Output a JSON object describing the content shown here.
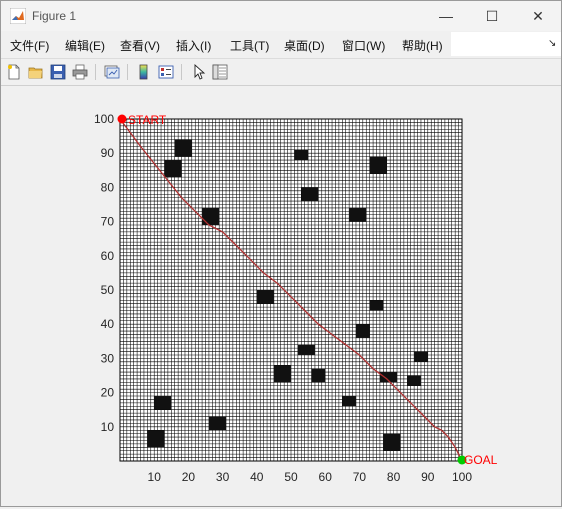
{
  "window": {
    "title": "Figure 1",
    "controls": {
      "minimize": "—",
      "maximize": "☐",
      "close": "✕"
    }
  },
  "menu": {
    "items": [
      {
        "label": "文件(F)"
      },
      {
        "label": "编辑(E)"
      },
      {
        "label": "查看(V)"
      },
      {
        "label": "插入(I)"
      },
      {
        "label": "工具(T)"
      },
      {
        "label": "桌面(D)"
      },
      {
        "label": "窗口(W)"
      },
      {
        "label": "帮助(H)"
      }
    ],
    "overflow_icon": "↘"
  },
  "toolbar": {
    "icons": [
      "new-figure-icon",
      "open-icon",
      "save-icon",
      "print-icon",
      "link-plot-icon",
      "colorbar-icon",
      "legend-icon",
      "edit-plot-icon",
      "property-inspector-icon"
    ]
  },
  "chart_data": {
    "type": "scatter",
    "grid": true,
    "grid_size": 100,
    "xlim": [
      0,
      100
    ],
    "ylim": [
      0,
      100
    ],
    "xticks": [
      "10",
      "20",
      "30",
      "40",
      "50",
      "60",
      "70",
      "80",
      "90",
      "100"
    ],
    "yticks": [
      "10",
      "20",
      "30",
      "40",
      "50",
      "60",
      "70",
      "80",
      "90",
      "100"
    ],
    "start": {
      "x": 0,
      "y": 100,
      "label": "START",
      "color": "#ff0000"
    },
    "goal": {
      "x": 100,
      "y": 0,
      "label": "GOAL",
      "color": "#00cc00",
      "label_color": "#ff0000"
    },
    "path_color": "#b03030",
    "path": [
      [
        0,
        100
      ],
      [
        3,
        96
      ],
      [
        6,
        92
      ],
      [
        10,
        87
      ],
      [
        14,
        82
      ],
      [
        18,
        77
      ],
      [
        22,
        73
      ],
      [
        26,
        69
      ],
      [
        30,
        67
      ],
      [
        34,
        63
      ],
      [
        38,
        59
      ],
      [
        42,
        55
      ],
      [
        46,
        52
      ],
      [
        50,
        48
      ],
      [
        54,
        44
      ],
      [
        58,
        40
      ],
      [
        62,
        37
      ],
      [
        66,
        34
      ],
      [
        70,
        31
      ],
      [
        74,
        27
      ],
      [
        78,
        24
      ],
      [
        82,
        20
      ],
      [
        86,
        16
      ],
      [
        88,
        14
      ],
      [
        90,
        12
      ],
      [
        92,
        10
      ],
      [
        94,
        9
      ],
      [
        96,
        7
      ],
      [
        98,
        4
      ],
      [
        100,
        0
      ]
    ],
    "obstacles": [
      {
        "x": 16,
        "y": 89,
        "w": 5,
        "h": 5
      },
      {
        "x": 13,
        "y": 83,
        "w": 5,
        "h": 5
      },
      {
        "x": 51,
        "y": 88,
        "w": 4,
        "h": 3
      },
      {
        "x": 73,
        "y": 84,
        "w": 5,
        "h": 5
      },
      {
        "x": 53,
        "y": 76,
        "w": 5,
        "h": 4
      },
      {
        "x": 24,
        "y": 69,
        "w": 5,
        "h": 5
      },
      {
        "x": 67,
        "y": 70,
        "w": 5,
        "h": 4
      },
      {
        "x": 40,
        "y": 46,
        "w": 5,
        "h": 4
      },
      {
        "x": 73,
        "y": 44,
        "w": 4,
        "h": 3
      },
      {
        "x": 69,
        "y": 36,
        "w": 4,
        "h": 4
      },
      {
        "x": 52,
        "y": 31,
        "w": 5,
        "h": 3
      },
      {
        "x": 86,
        "y": 29,
        "w": 4,
        "h": 3
      },
      {
        "x": 45,
        "y": 23,
        "w": 5,
        "h": 5
      },
      {
        "x": 56,
        "y": 23,
        "w": 4,
        "h": 4
      },
      {
        "x": 76,
        "y": 23,
        "w": 5,
        "h": 3
      },
      {
        "x": 84,
        "y": 22,
        "w": 4,
        "h": 3
      },
      {
        "x": 65,
        "y": 16,
        "w": 4,
        "h": 3
      },
      {
        "x": 10,
        "y": 15,
        "w": 5,
        "h": 4
      },
      {
        "x": 26,
        "y": 9,
        "w": 5,
        "h": 4
      },
      {
        "x": 8,
        "y": 4,
        "w": 5,
        "h": 5
      },
      {
        "x": 77,
        "y": 3,
        "w": 5,
        "h": 5
      }
    ]
  }
}
